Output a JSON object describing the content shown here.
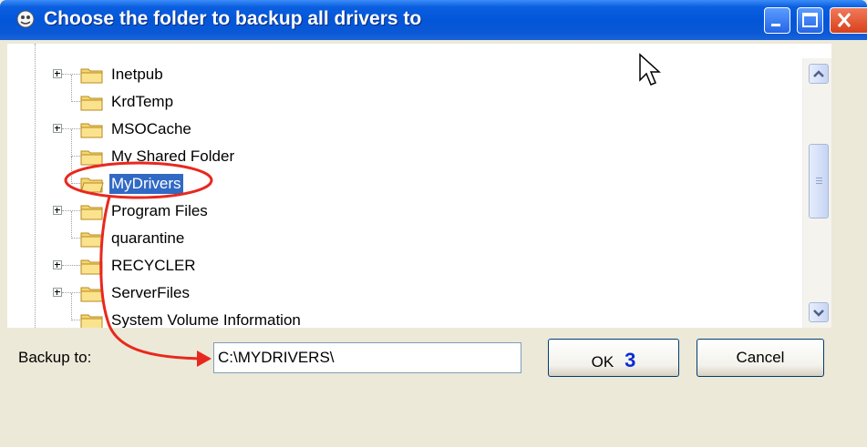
{
  "window": {
    "title": "Choose the folder to backup all drivers to",
    "controls": [
      "minimize",
      "maximize",
      "close"
    ]
  },
  "tree": {
    "items": [
      {
        "label": "Inetpub",
        "expandable": true
      },
      {
        "label": "KrdTemp",
        "expandable": false
      },
      {
        "label": "MSOCache",
        "expandable": true
      },
      {
        "label": "My Shared Folder",
        "expandable": false
      },
      {
        "label": "MyDrivers",
        "expandable": false,
        "selected": true
      },
      {
        "label": "Program Files",
        "expandable": true
      },
      {
        "label": "quarantine",
        "expandable": false
      },
      {
        "label": "RECYCLER",
        "expandable": true
      },
      {
        "label": "ServerFiles",
        "expandable": true
      },
      {
        "label": "System Volume Information",
        "expandable": false
      }
    ]
  },
  "backup": {
    "label": "Backup to:",
    "value": "C:\\MYDRIVERS\\"
  },
  "buttons": {
    "ok": "OK",
    "ok_step": "3",
    "cancel": "Cancel"
  },
  "colors": {
    "titlebar": "#0a5ee0",
    "selection": "#316ac5",
    "annotation": "#e8281e",
    "step_badge": "#0b2bd8"
  }
}
